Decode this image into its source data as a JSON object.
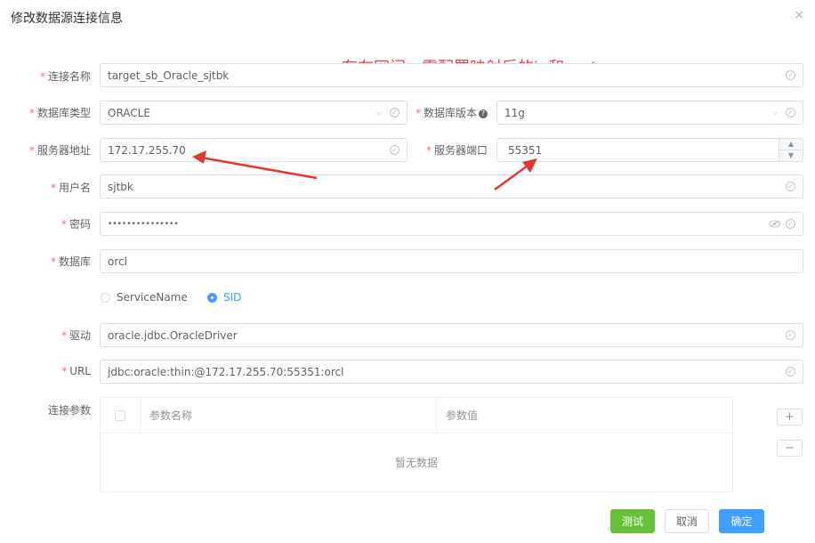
{
  "dialog": {
    "title": "修改数据源连接信息",
    "close_glyph": "×"
  },
  "annotation": "存在网闸，需配置映射后的ip和port",
  "form": {
    "required_mark": "*",
    "name": {
      "label": "连接名称",
      "value": "target_sb_Oracle_sjtbk"
    },
    "db_type": {
      "label": "数据库类型",
      "value": "ORACLE"
    },
    "db_version": {
      "label": "数据库版本",
      "help": "?",
      "value": "11g"
    },
    "host": {
      "label": "服务器地址",
      "value": "172.17.255.70"
    },
    "port": {
      "label": "服务器端口",
      "value": "55351"
    },
    "user": {
      "label": "用户名",
      "value": "sjtbk"
    },
    "password": {
      "label": "密码",
      "value": "•••••••••••••••"
    },
    "database": {
      "label": "数据库",
      "value": "orcl"
    },
    "mode": {
      "options": [
        "ServiceName",
        "SID"
      ],
      "selected": "SID"
    },
    "driver": {
      "label": "驱动",
      "value": "oracle.jdbc.OracleDriver"
    },
    "url": {
      "label": "URL",
      "value": "jdbc:oracle:thin:@172.17.255.70:55351:orcl"
    },
    "params": {
      "label": "连接参数",
      "columns": [
        "参数名称",
        "参数值"
      ],
      "empty_text": "暂无数据",
      "add_glyph": "+",
      "remove_glyph": "−"
    }
  },
  "buttons": {
    "test": "测试",
    "cancel": "取消",
    "ok": "确定"
  },
  "colors": {
    "primary": "#409eff",
    "success": "#67c23a",
    "required": "#f56c6c",
    "annotation": "#f03c3c"
  }
}
